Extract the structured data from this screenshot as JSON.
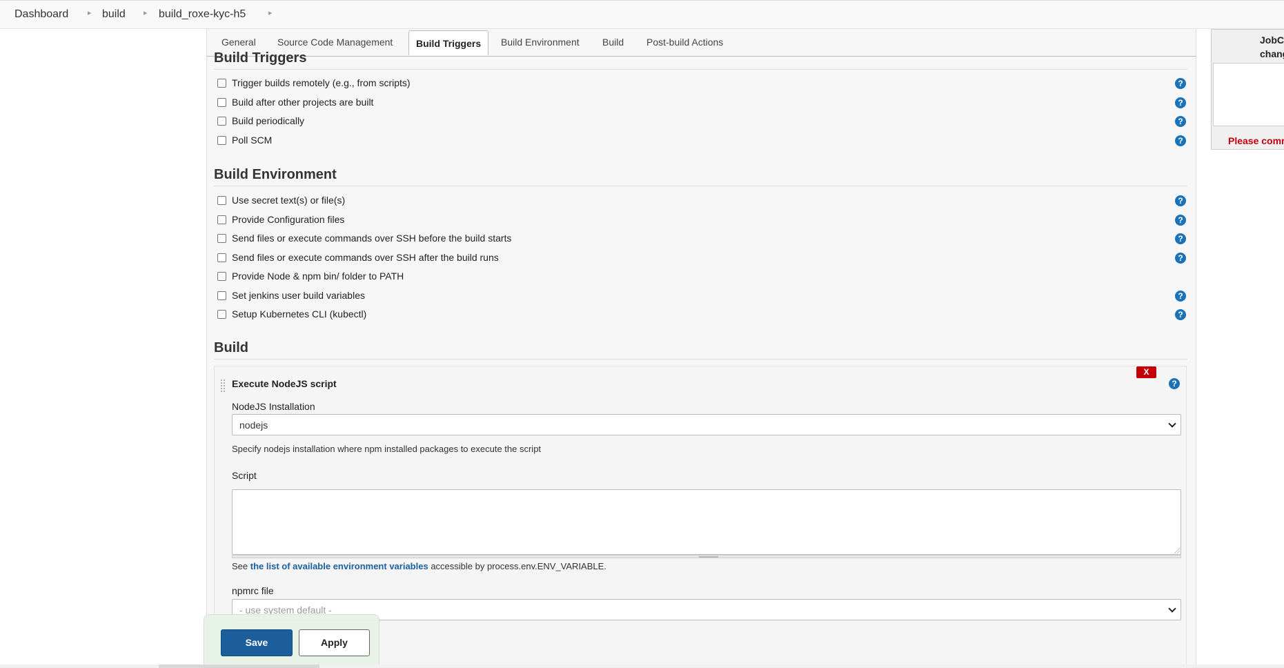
{
  "breadcrumb": {
    "items": [
      "Dashboard",
      "build",
      "build_roxe-kyc-h5"
    ]
  },
  "tabs": [
    {
      "label": "General",
      "active": false
    },
    {
      "label": "Source Code Management",
      "active": false
    },
    {
      "label": "Build Triggers",
      "active": true
    },
    {
      "label": "Build Environment",
      "active": false
    },
    {
      "label": "Build",
      "active": false
    },
    {
      "label": "Post-build Actions",
      "active": false
    }
  ],
  "build_triggers": {
    "title": "Build Triggers",
    "options": [
      {
        "label": "Trigger builds remotely (e.g., from scripts)",
        "checked": false
      },
      {
        "label": "Build after other projects are built",
        "checked": false
      },
      {
        "label": "Build periodically",
        "checked": false
      },
      {
        "label": "Poll SCM",
        "checked": false
      }
    ]
  },
  "build_environment": {
    "title": "Build Environment",
    "options": [
      {
        "label": "Use secret text(s) or file(s)",
        "checked": false
      },
      {
        "label": "Provide Configuration files",
        "checked": false
      },
      {
        "label": "Send files or execute commands over SSH before the build starts",
        "checked": false
      },
      {
        "label": "Send files or execute commands over SSH after the build runs",
        "checked": false
      },
      {
        "label": "Provide Node & npm bin/ folder to PATH",
        "checked": false
      },
      {
        "label": "Set jenkins user build variables",
        "checked": false
      },
      {
        "label": "Setup Kubernetes CLI (kubectl)",
        "checked": false
      }
    ]
  },
  "build": {
    "title": "Build",
    "step": {
      "title": "Execute NodeJS script",
      "delete_label": "X",
      "installation_label": "NodeJS Installation",
      "installation_value": "nodejs",
      "installation_desc": "Specify nodejs installation where npm installed packages to execute the script",
      "script_label": "Script",
      "script_value": "",
      "env_prefix": "See",
      "env_link": "the list of available environment variables",
      "env_suffix": "accessible by process.env.ENV_VARIABLE.",
      "npmrc_label": "npmrc file",
      "npmrc_value": "- use system default -"
    }
  },
  "help_glyph": "?",
  "buttons": {
    "save": "Save",
    "apply": "Apply"
  },
  "side_widget": {
    "title_line1": "JobC",
    "title_line2": "chang",
    "error": "Please comr"
  },
  "colors": {
    "primary_button": "#1b5e9b",
    "help_icon": "#1a72b8",
    "delete_button": "#c4000a",
    "link": "#1a5fa0",
    "error_text": "#c4000a"
  }
}
